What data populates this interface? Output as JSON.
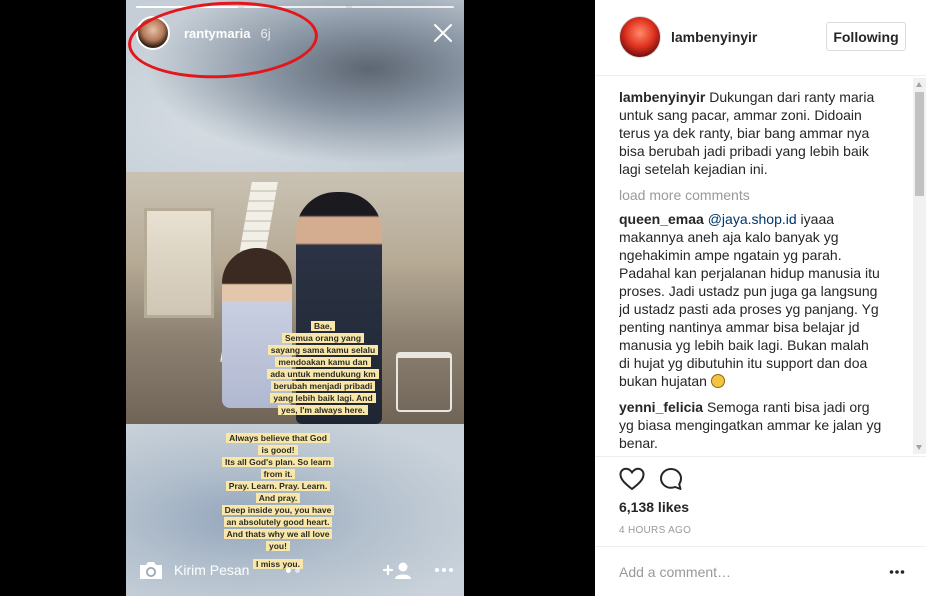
{
  "story": {
    "username": "rantymaria",
    "time": "6j",
    "progress_segments": 3,
    "active_segment": 1,
    "sticker_top": [
      "Bae,",
      "Semua orang yang",
      "sayang sama kamu selalu",
      "mendoakan kamu dan",
      "ada untuk mendukung km",
      "berubah menjadi pribadi",
      "yang lebih baik lagi. And",
      "yes, I'm always here."
    ],
    "sticker_bottom": [
      "Always believe that God",
      "is good!",
      "Its all God's plan. So learn",
      "from it.",
      "Pray. Learn. Pray. Learn.",
      "And pray.",
      "Deep inside you, you have",
      "an absolutely good heart.",
      "And thats why we all love",
      "you!",
      "",
      "I miss you."
    ],
    "reply_label": "Kirim Pesan",
    "annotation_color": "#e3161b"
  },
  "post": {
    "username": "lambenyinyir",
    "follow_label": "Following",
    "caption_user": "lambenyinyir",
    "caption_text": "Dukungan dari ranty maria untuk sang pacar, ammar zoni. Didoain terus ya dek ranty, biar bang ammar nya bisa berubah jadi pribadi yang lebih baik lagi setelah kejadian ini.",
    "load_more": "load more comments",
    "comments": [
      {
        "user": "queen_emaa",
        "mention": "@jaya.shop.id",
        "text": "iyaaa makannya aneh aja kalo banyak yg ngehakimin ampe ngatain yg parah. Padahal kan perjalanan hidup manusia itu proses. Jadi ustadz pun juga ga langsung jd ustadz pasti ada proses yg panjang. Yg penting nantinya ammar bisa belajar jd manusia yg lebih baik lagi. Bukan malah di hujat yg dibutuhin itu support dan doa bukan hujatan"
      },
      {
        "user": "yenni_felicia",
        "text": "Semoga ranti bisa jadi org yg biasa mengingatkan ammar ke jalan yg benar."
      }
    ],
    "likes": "6,138 likes",
    "time": "4 HOURS AGO",
    "add_comment_placeholder": "Add a comment…"
  }
}
